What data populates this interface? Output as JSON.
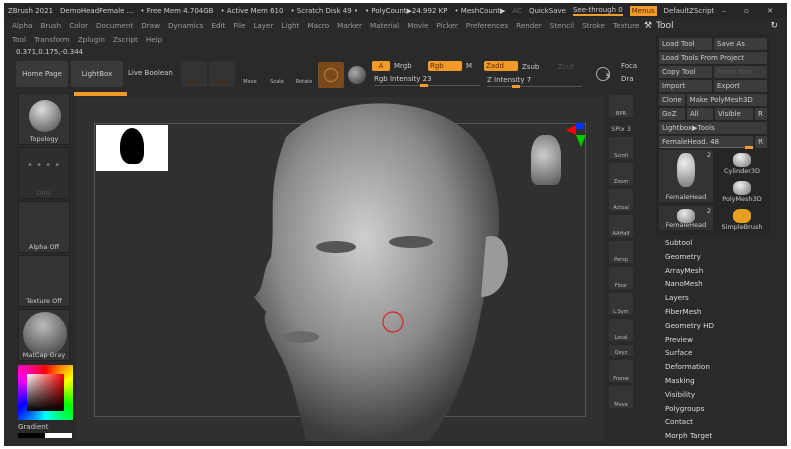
{
  "titlebar": {
    "app": "ZBrush 2021",
    "doc": "DemoHeadFemale ...",
    "free_mem": "• Free Mem 4.704GB",
    "active_mem": "• Active Mem 610",
    "scratch": "• Scratch Disk 49 •",
    "polycount": "• PolyCount▶24.992 KP",
    "meshcount": "• MeshCount▶",
    "ac": "AC",
    "quicksave": "QuickSave",
    "see_through": "See-through 0",
    "menus": "Menus",
    "default_zscript": "DefaultZScript"
  },
  "menu_row1": [
    "Alpha",
    "Brush",
    "Color",
    "Document",
    "Draw",
    "Dynamics",
    "Edit",
    "File",
    "Layer",
    "Light",
    "Macro",
    "Marker",
    "Material",
    "Movie",
    "Picker",
    "Preferences",
    "Render",
    "Stencil",
    "Stroke",
    "Texture"
  ],
  "menu_row2": [
    "Tool",
    "Transform",
    "Zplugin",
    "Zscript",
    "Help"
  ],
  "coords": "0.371,0.175,-0.344",
  "toolbar": {
    "home": "Home Page",
    "lightbox": "LightBox",
    "live_boolean": "Live Boolean",
    "edit": "Edit",
    "draw": "Draw",
    "move": "Move",
    "scale": "Scale",
    "rotate": "Rotate",
    "a": "A",
    "mrgb": "Mrgb",
    "rgb": "Rgb",
    "m": "M",
    "zadd": "Zadd",
    "zsub": "Zsub",
    "zcut": "Zcut",
    "rgb_intensity": "Rgb Intensity 23",
    "z_intensity": "Z Intensity 7",
    "draw_size": "5",
    "focal": "Foca",
    "draw2": "Dra"
  },
  "progress": {
    "rgb_intensity": 23,
    "z_intensity": 7
  },
  "left_shelf": {
    "topology": "Topology",
    "dots": "Dots",
    "alpha": "Alpha Off",
    "texture": "Texture Off",
    "matcap": "MatCap Gray",
    "gradient": "Gradient"
  },
  "right_shelf": {
    "bpr": "BPR",
    "spix": "SPix 3",
    "scroll": "Scroll",
    "zoom": "Zoom",
    "actual": "Actual",
    "aahalf": "AAHalf",
    "persp": "Persp",
    "floor": "Floor",
    "lsym": "L.Sym",
    "local": "Local",
    "xyz": "Qxyz",
    "frame": "Frame",
    "move": "Move"
  },
  "tool_panel": {
    "title": "Tool",
    "load_tool": "Load Tool",
    "save_as": "Save As",
    "load_project": "Load Tools From Project",
    "copy_tool": "Copy Tool",
    "paste_tool": "Paste Tool",
    "import": "Import",
    "export": "Export",
    "clone": "Clone",
    "make_polymesh": "Make PolyMesh3D",
    "goz": "GoZ",
    "all": "All",
    "visible": "Visible",
    "r": "R",
    "lightbox_tools": "Lightbox▶Tools",
    "current": "FemaleHead. 48",
    "thumbs": [
      {
        "label": "FemaleHead",
        "badge": "2"
      },
      {
        "label": "Cylinder3D"
      },
      {
        "label": "PolyMesh3D"
      },
      {
        "label": "FemaleHead",
        "badge": "2"
      },
      {
        "label": "SimpleBrush"
      }
    ],
    "sections": [
      "Subtool",
      "Geometry",
      "ArrayMesh",
      "NanoMesh",
      "Layers",
      "FiberMesh",
      "Geometry HD",
      "Preview",
      "Surface",
      "Deformation",
      "Masking",
      "Visibility",
      "Polygroups",
      "Contact",
      "Morph Target"
    ]
  },
  "colors": {
    "accent": "#f39a2b",
    "bg": "#2a2a2a"
  }
}
